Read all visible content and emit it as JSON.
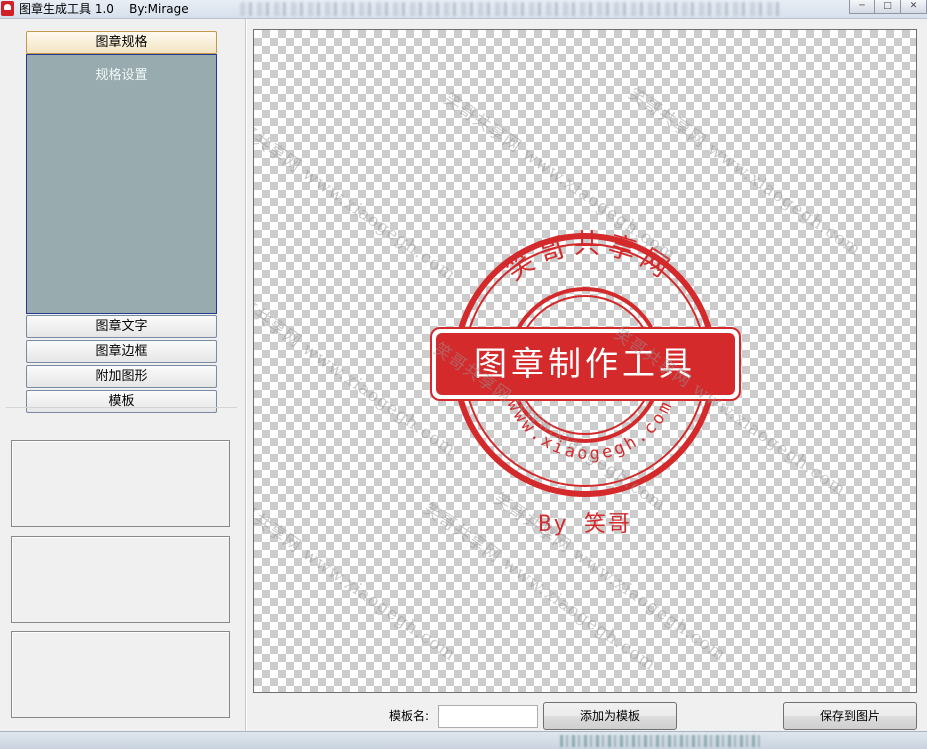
{
  "window": {
    "title": "图章生成工具 1.0    By:Mirage",
    "controls": [
      "minimize",
      "maximize",
      "close"
    ]
  },
  "sidebar": {
    "sections": [
      {
        "label": "图章规格",
        "active": true
      },
      {
        "label": "图章文字",
        "active": false
      },
      {
        "label": "图章边框",
        "active": false
      },
      {
        "label": "附加图形",
        "active": false
      },
      {
        "label": "模板",
        "active": false
      }
    ],
    "active_content_label": "规格设置"
  },
  "stamp": {
    "color": "#d42a2c",
    "top_text": "笑哥共享网",
    "center_text": "图章制作工具",
    "bottom_text": "www.xiaogegh.com",
    "signature": "By 笑哥"
  },
  "watermark": {
    "text": "笑哥共享网 www.xiaogegh.com"
  },
  "bottom_bar": {
    "template_name_label": "模板名:",
    "template_name_value": "",
    "add_template_button": "添加为模板",
    "save_image_button": "保存到图片"
  },
  "colors": {
    "panel_bg": "#f0f0f0",
    "accordion_content_bg": "#98acb0",
    "active_section_bg": "#f2e4c2",
    "stamp_red": "#d42a2c"
  }
}
